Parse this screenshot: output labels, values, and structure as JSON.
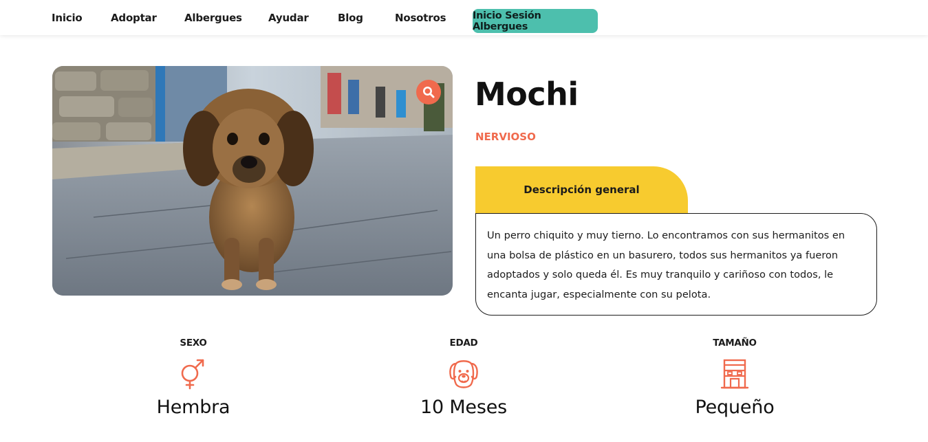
{
  "nav": {
    "items": [
      "Inicio",
      "Adoptar",
      "Albergues",
      "Ayudar",
      "Blog",
      "Nosotros"
    ],
    "cta": "Inicio Sesión Albergues"
  },
  "pet": {
    "name": "Mochi",
    "temperament": "NERVIOSO",
    "tab_label": "Descripción general",
    "description": "Un perro chiquito y muy tierno. Lo encontramos con sus hermanitos en una bolsa de plástico en un basurero, todos sus hermanitos ya fueron adoptados y solo queda él. Es muy tranquilo y cariñoso con todos, le encanta jugar, especialmente con su pelota."
  },
  "stats": [
    {
      "label": "SEXO",
      "value": "Hembra",
      "icon": "female-male-symbol-icon"
    },
    {
      "label": "EDAD",
      "value": "10 Meses",
      "icon": "dog-face-icon"
    },
    {
      "label": "TAMAÑO",
      "value": "Pequeño",
      "icon": "dog-house-icon"
    }
  ],
  "colors": {
    "accent": "#f06a4d",
    "cta": "#4dbfad",
    "tab": "#f7cb2f"
  }
}
